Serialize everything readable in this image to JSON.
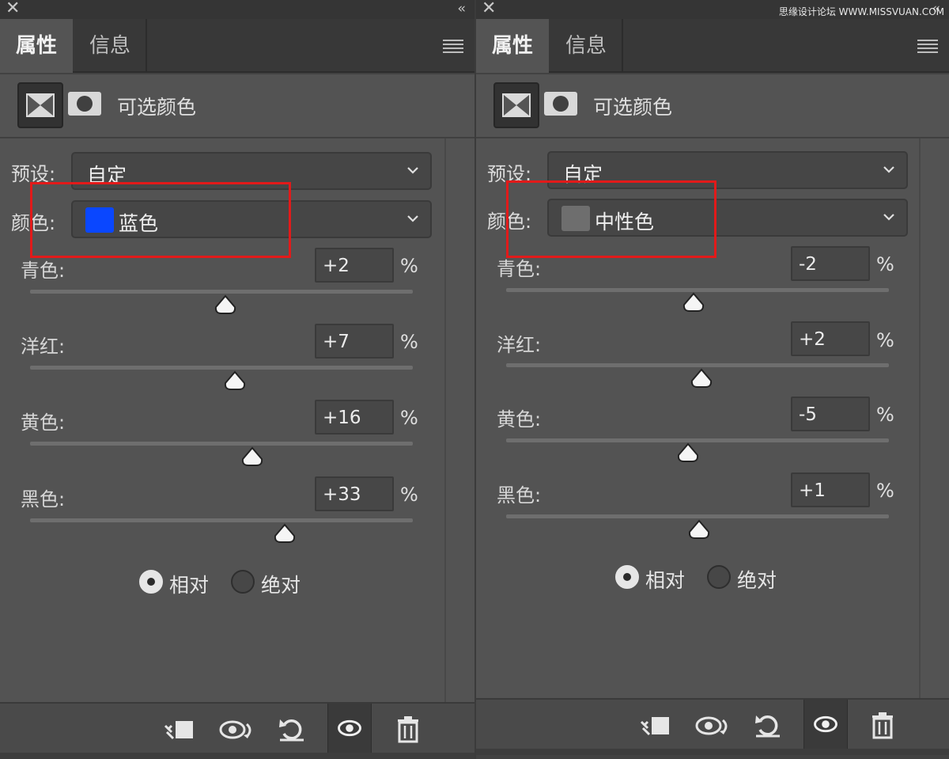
{
  "watermark": "思缘设计论坛 WWW.MISSVUAN.COM",
  "panels": [
    {
      "tabs": {
        "active": "属性",
        "inactive": "信息"
      },
      "title": "可选颜色",
      "preset_label": "预设:",
      "preset_value": "自定",
      "color_label": "颜色:",
      "color_value": "蓝色",
      "swatch_color": "#0a47ff",
      "sliders": [
        {
          "label": "青色:",
          "value": "+2",
          "level": 2
        },
        {
          "label": "洋红:",
          "value": "+7",
          "level": 7
        },
        {
          "label": "黄色:",
          "value": "+16",
          "level": 16
        },
        {
          "label": "黑色:",
          "value": "+33",
          "level": 33
        }
      ],
      "unit": "%",
      "radio_relative": "相对",
      "radio_absolute": "绝对"
    },
    {
      "tabs": {
        "active": "属性",
        "inactive": "信息"
      },
      "title": "可选颜色",
      "preset_label": "预设:",
      "preset_value": "自定",
      "color_label": "颜色:",
      "color_value": "中性色",
      "swatch_color": "#6e6e6e",
      "sliders": [
        {
          "label": "青色:",
          "value": "-2",
          "level": -2
        },
        {
          "label": "洋红:",
          "value": "+2",
          "level": 2
        },
        {
          "label": "黄色:",
          "value": "-5",
          "level": -5
        },
        {
          "label": "黑色:",
          "value": "+1",
          "level": 1
        }
      ],
      "unit": "%",
      "radio_relative": "相对",
      "radio_absolute": "绝对"
    }
  ],
  "colors": {
    "highlight": "#e21a1a",
    "panel_bg": "#535353"
  },
  "icons": {
    "close": "close-icon",
    "collapse": "double-chevron-left-icon",
    "menu": "hamburger-menu-icon",
    "adjustment": "selective-color-adjustment-icon",
    "mask": "layer-mask-icon",
    "clip": "clip-to-layer-icon",
    "view_previous": "view-previous-state-icon",
    "reset": "reset-icon",
    "visibility": "eye-icon",
    "delete": "trash-icon"
  }
}
